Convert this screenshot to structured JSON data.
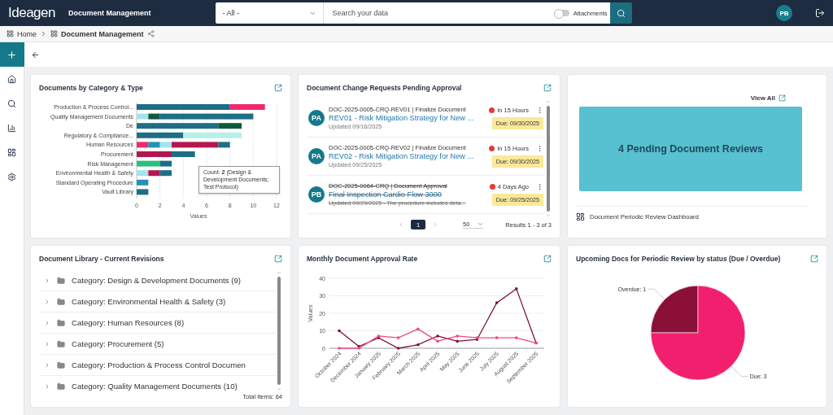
{
  "topbar": {
    "logo": "Ideagen",
    "app_title": "Document Management",
    "scope_select": "- All -",
    "search": {
      "placeholder": "Search your data"
    },
    "attachments": {
      "label": "Attachments",
      "on": false
    },
    "user_initials": "PB"
  },
  "breadcrumb": [
    {
      "label": "Home"
    },
    {
      "label": "Document Management"
    }
  ],
  "sidebar": {
    "items": [
      {
        "kind": "add",
        "selected": true
      },
      {
        "kind": "home",
        "selected": false
      },
      {
        "kind": "search",
        "selected": false
      },
      {
        "kind": "reports",
        "selected": false
      },
      {
        "kind": "dashboards",
        "selected": false
      },
      {
        "kind": "settings",
        "selected": false
      }
    ]
  },
  "category_chart": {
    "title": "Documents by Category & Type",
    "tooltip": "Count: **2** (Design & Development Documents; Test Protocol)",
    "chart_data": {
      "type": "bar",
      "orientation": "horizontal",
      "stacked": true,
      "grid": true,
      "xlabel": "Values",
      "xlim": [
        0,
        12
      ],
      "xticks": [
        0,
        2,
        4,
        6,
        8,
        10,
        12
      ],
      "categories": [
        "Production & Process Control...",
        "Quality Management Documents",
        "De",
        "Regulatory & Compliance...",
        "Human Resources",
        "Procurement",
        "Risk Management",
        "Environmental Health & Safety",
        "Standard Operating Procedure",
        "Vault Library"
      ],
      "series": [
        {
          "color": "#a6e3ec",
          "values": [
            0,
            1,
            0,
            0,
            0,
            0,
            0,
            1,
            0,
            0
          ]
        },
        {
          "color": "#ef2a6c",
          "values": [
            0,
            0,
            0,
            0,
            1,
            0,
            0,
            0,
            0,
            0
          ]
        },
        {
          "color": "#2592b3",
          "values": [
            0,
            0,
            0,
            0,
            1,
            0,
            0,
            0,
            1,
            0
          ]
        },
        {
          "color": "#a6e3ec",
          "values": [
            0,
            0,
            0,
            0,
            1,
            0,
            0,
            0,
            0,
            0
          ]
        },
        {
          "color": "#29c07f",
          "values": [
            0,
            0,
            0,
            0,
            0,
            0,
            2,
            0,
            0,
            0
          ]
        },
        {
          "color": "#b3174e",
          "values": [
            0,
            0,
            0,
            0,
            4,
            3,
            0,
            1,
            0,
            0
          ]
        },
        {
          "color": "#0f5a3e",
          "values": [
            0,
            1,
            0,
            0,
            0,
            0,
            0,
            0,
            0,
            0
          ]
        },
        {
          "color": "#1d6f86",
          "values": [
            8,
            8,
            7,
            4,
            1,
            2,
            1,
            1,
            0,
            1
          ]
        },
        {
          "color": "#b5f0ea",
          "values": [
            0,
            0,
            0,
            5,
            0,
            0,
            0,
            0,
            0,
            0
          ]
        },
        {
          "color": "#0f5a3e",
          "values": [
            0,
            0,
            2,
            0,
            0,
            0,
            0,
            0,
            0,
            0
          ]
        },
        {
          "color": "#ef2a6c",
          "values": [
            3,
            0,
            0,
            0,
            0,
            0,
            0,
            0,
            0,
            0
          ]
        }
      ]
    }
  },
  "change_requests": {
    "title": "Document Change Requests Pending Approval",
    "items": [
      {
        "initials": "PA",
        "reference": "DOC-2025-0005-CRQ-REV01 | Finalize Document",
        "name": "REV01 - Risk Mitigation Strategy for New ...",
        "updated": "Updated 09/16/2025",
        "timing": "In 15 Hours",
        "due": "Due: 09/30/2025",
        "completed": false
      },
      {
        "initials": "PA",
        "reference": "DOC-2025-0005-CRQ-REV02 | Finalize Document",
        "name": "REV02 - Risk Mitigation Strategy for New ...",
        "updated": "Updated 09/25/2025",
        "timing": "In 15 Hours",
        "due": "Due: 09/30/2025",
        "completed": false
      },
      {
        "initials": "PB",
        "reference": "DOC-2025-0064-CRQ | Document Approval",
        "name": "Final Inspection Cardio Flow 3000",
        "updated": "Updated 09/29/2025 - The procedure includes deta...",
        "timing": "4 Days Ago",
        "due": "Due: 09/25/2025",
        "completed": true
      }
    ],
    "pages": [
      {
        "label": "1",
        "selected": true
      }
    ],
    "page_size": "50",
    "results": "Results 1 - 3 of 3"
  },
  "periodic_reviews": {
    "view_all": "View All",
    "banner": "4 Pending Document Reviews",
    "dashboard_link": "Document Periodic Review Dashboard"
  },
  "library": {
    "title": "Document Library - Current Revisions",
    "items": [
      {
        "label": "Category: Design & Development Documents (9)",
        "expanded": false
      },
      {
        "label": "Category: Environmental Health & Safety (3)",
        "expanded": false
      },
      {
        "label": "Category: Human Resources (8)",
        "expanded": false
      },
      {
        "label": "Category: Procurement (5)",
        "expanded": false
      },
      {
        "label": "Category: Production & Process Control Documen",
        "expanded": false
      },
      {
        "label": "Category: Quality Management Documents (10)",
        "expanded": false
      }
    ],
    "total": "Total Items: 64"
  },
  "approval_rate": {
    "title": "Monthly Document Approval Rate",
    "chart_data": {
      "type": "line",
      "grid": true,
      "ylabel": "Values",
      "ylim": [
        0,
        40
      ],
      "yticks": [
        0,
        10,
        20,
        30,
        40
      ],
      "categories": [
        "October 2024",
        "December 2024",
        "January 2025",
        "February 2025",
        "March 2025",
        "April 2025",
        "May 2025",
        "June 2025",
        "July 2025",
        "August 2025",
        "September 2025"
      ],
      "series": [
        {
          "color": "#7d1334",
          "values": [
            10,
            1,
            6,
            0,
            2,
            7,
            4,
            5,
            26,
            34,
            3
          ]
        },
        {
          "color": "#ee4a80",
          "values": [
            0,
            0,
            7,
            6,
            11,
            4,
            7,
            6,
            6,
            6,
            3
          ]
        }
      ]
    }
  },
  "review_status": {
    "title": "Upcoming Docs for Periodic Review by status (Due / Overdue)",
    "chart_data": {
      "type": "pie",
      "categories": [
        "Overdue: 1",
        "Due: 3"
      ],
      "values": [
        1,
        3
      ],
      "colors": [
        "#8a1038",
        "#f21f6f"
      ]
    }
  }
}
